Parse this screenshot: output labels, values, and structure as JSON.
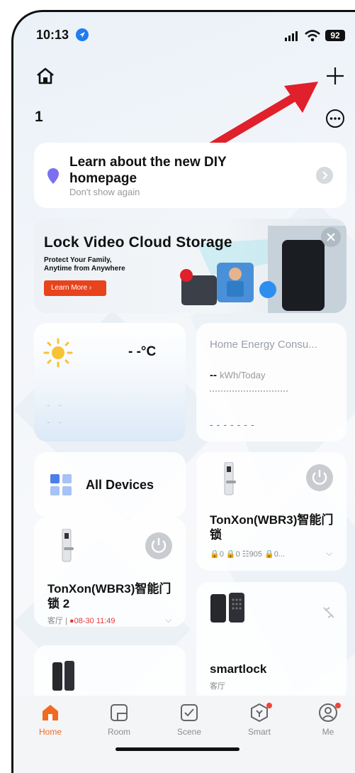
{
  "status": {
    "time": "10:13",
    "battery": "92"
  },
  "header": {
    "home_number": "1"
  },
  "tip": {
    "title": "Learn about the new DIY homepage",
    "dismiss": "Don't show again"
  },
  "banner": {
    "title": "Lock Video Cloud Storage",
    "subtitle_line1": "Protect Your Family,",
    "subtitle_line2": "Anytime from Anywhere",
    "button": "Learn More"
  },
  "weather": {
    "temp": "- -°C"
  },
  "energy": {
    "title": "Home Energy Consu...",
    "value": "--",
    "unit": "kWh/Today"
  },
  "all_devices": {
    "label": "All Devices"
  },
  "devices": [
    {
      "name": "TonXon(WBR3)智能门锁",
      "meta": "🔒0  🔒0  ☷905  🔒0..."
    },
    {
      "name": "TonXon(WBR3)智能门锁 2",
      "room": "客厅",
      "alert": "08-30 11:49"
    },
    {
      "name": "smartlock",
      "room": "客厅"
    }
  ],
  "tabs": [
    {
      "label": "Home"
    },
    {
      "label": "Room"
    },
    {
      "label": "Scene"
    },
    {
      "label": "Smart"
    },
    {
      "label": "Me"
    }
  ],
  "colors": {
    "accent": "#f26a21",
    "banner_button": "#e8431d",
    "arrow": "#e0202a",
    "badge": "#f0453a"
  }
}
